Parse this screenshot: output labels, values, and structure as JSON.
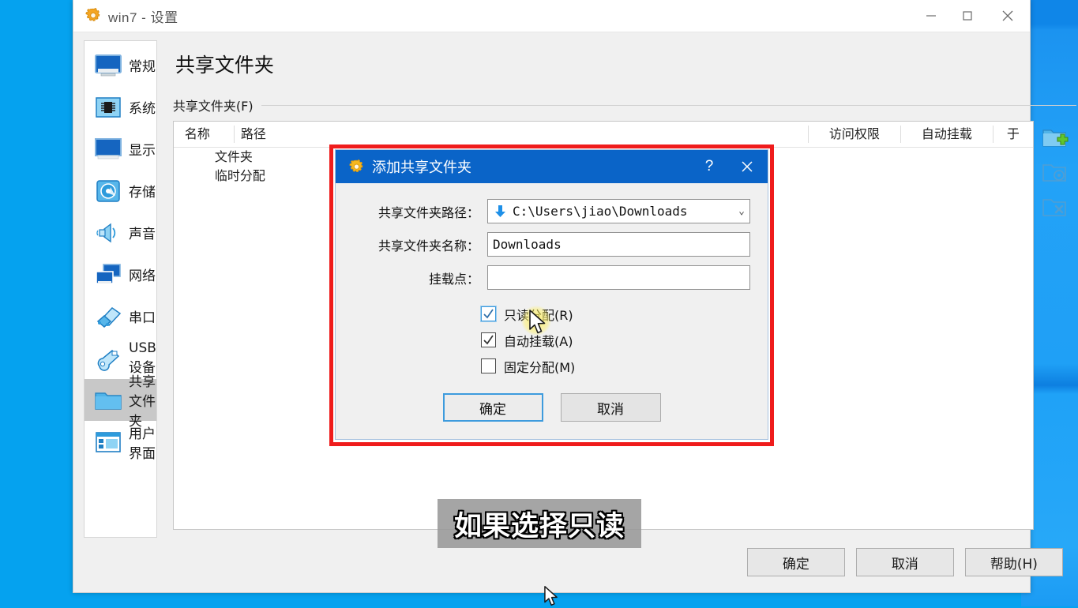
{
  "window": {
    "title": "win7 - 设置",
    "title_icon": "gear-icon",
    "controls": {
      "minimize": "—",
      "maximize": "□",
      "close": "✕"
    }
  },
  "sidebar": {
    "items": [
      {
        "label": "常规",
        "icon": "monitor-icon",
        "selected": false
      },
      {
        "label": "系统",
        "icon": "chip-icon",
        "selected": false
      },
      {
        "label": "显示",
        "icon": "display-icon",
        "selected": false
      },
      {
        "label": "存储",
        "icon": "harddisk-icon",
        "selected": false
      },
      {
        "label": "声音",
        "icon": "speaker-icon",
        "selected": false
      },
      {
        "label": "网络",
        "icon": "network-icon",
        "selected": false
      },
      {
        "label": "串口",
        "icon": "serialport-icon",
        "selected": false
      },
      {
        "label": "USB设备",
        "icon": "usb-icon",
        "selected": false
      },
      {
        "label": "共享文件夹",
        "icon": "folder-icon",
        "selected": true
      },
      {
        "label": "用户界面",
        "icon": "ui-window-icon",
        "selected": false
      }
    ]
  },
  "main": {
    "page_title": "共享文件夹",
    "group_label": "共享文件夹(F)",
    "table": {
      "columns": [
        "名称",
        "路径",
        "访问权限",
        "自动挂载",
        "于"
      ],
      "groups": [
        "文件夹",
        "临时分配"
      ]
    },
    "tools": [
      {
        "name": "add-shared-folder-icon",
        "enabled": true
      },
      {
        "name": "edit-shared-folder-icon",
        "enabled": false
      },
      {
        "name": "remove-shared-folder-icon",
        "enabled": false
      }
    ],
    "footer_buttons": [
      "确定",
      "取消",
      "帮助(H)"
    ]
  },
  "dialog": {
    "title": "添加共享文件夹",
    "title_icon": "gear-icon",
    "help_label": "?",
    "close_label": "✕",
    "fields": [
      {
        "label": "共享文件夹路径：",
        "value": "C:\\Users\\jiao\\Downloads",
        "icon": "down-arrow-icon",
        "type": "combobox",
        "placeholder": ""
      },
      {
        "label": "共享文件夹名称：",
        "value": "Downloads",
        "type": "text",
        "placeholder": ""
      },
      {
        "label": "挂载点：",
        "value": "",
        "type": "text",
        "placeholder": ""
      }
    ],
    "checkboxes": [
      {
        "label": "只读分配(R)",
        "checked": true,
        "focused": true
      },
      {
        "label": "自动挂载(A)",
        "checked": true,
        "focused": false
      },
      {
        "label": "固定分配(M)",
        "checked": false,
        "focused": false
      }
    ],
    "buttons": [
      {
        "label": "确定",
        "default": true
      },
      {
        "label": "取消",
        "default": false
      }
    ]
  },
  "caption": {
    "text": "如果选择只读"
  },
  "colors": {
    "desktop_blue": "#03a3f0",
    "dialog_title_blue": "#0a64c8",
    "annotation_red": "#ef1c1c",
    "selection_gray": "#c8c8c8",
    "accent_focus": "#3d9bdd",
    "caption_band": "#969696"
  }
}
